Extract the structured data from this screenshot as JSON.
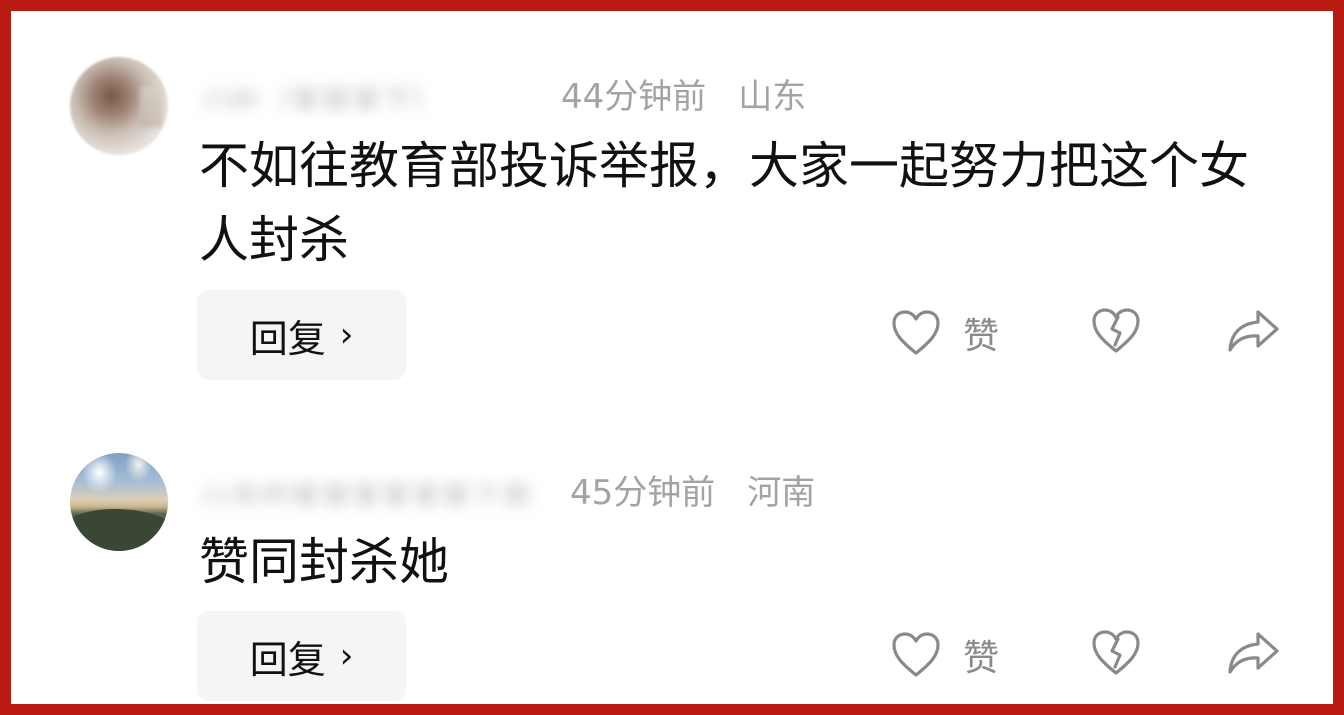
{
  "comments": [
    {
      "username": "小叶（某某某下）",
      "time": "44分钟前",
      "region": "山东",
      "content": "不如往教育部投诉举报，大家一起努力把这个女人封杀",
      "reply_label": "回复",
      "reply_chevron": "›",
      "like_label": "赞",
      "avatar": "blurred-portrait"
    },
    {
      "username": "山东的某某某某某某之声",
      "time": "45分钟前",
      "region": "河南",
      "content": "赞同封杀她",
      "reply_label": "回复",
      "reply_chevron": "›",
      "like_label": "赞",
      "avatar": "mountain-landscape"
    }
  ],
  "icons": {
    "like": "heart-outline-icon",
    "dislike": "broken-heart-icon",
    "share": "share-arrow-icon"
  },
  "colors": {
    "frame_border": "#b91a12",
    "meta_text": "#a3a3a3",
    "body_text": "#111111",
    "reply_bg": "#f5f5f5",
    "icon_stroke": "#8a8a8a"
  }
}
